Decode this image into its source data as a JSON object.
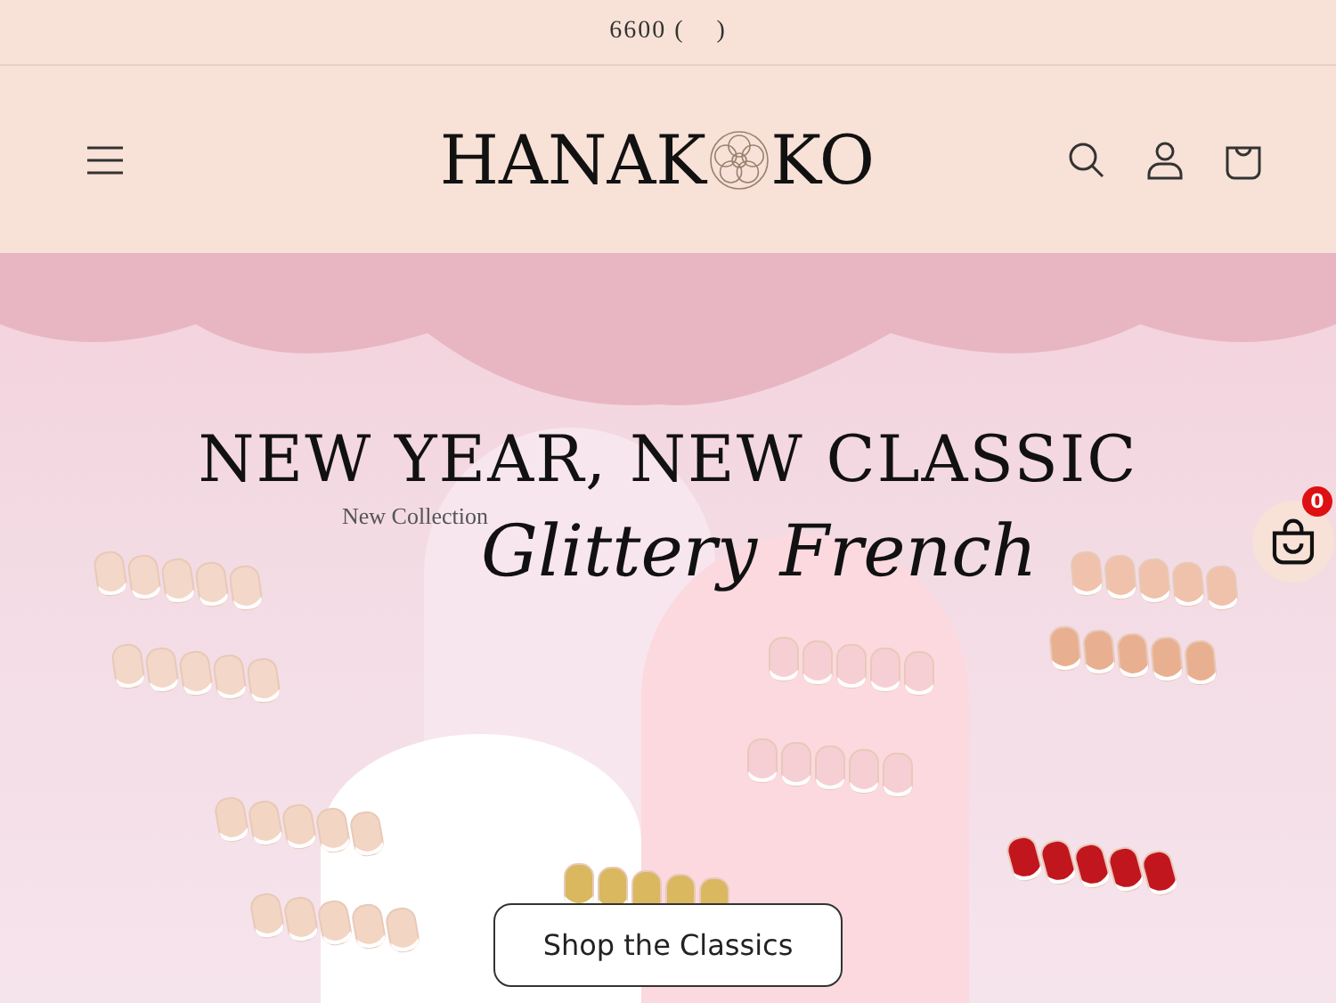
{
  "announcement": {
    "text": "6600 (    )"
  },
  "header": {
    "logo": {
      "before": "HANAK",
      "after": "KO"
    }
  },
  "hero": {
    "headline": "NEW YEAR, NEW CLASSIC",
    "eyebrow": "New Collection",
    "script_title": "Glittery French",
    "button": "Shop the Classics"
  },
  "floating_cart": {
    "count": "0"
  }
}
